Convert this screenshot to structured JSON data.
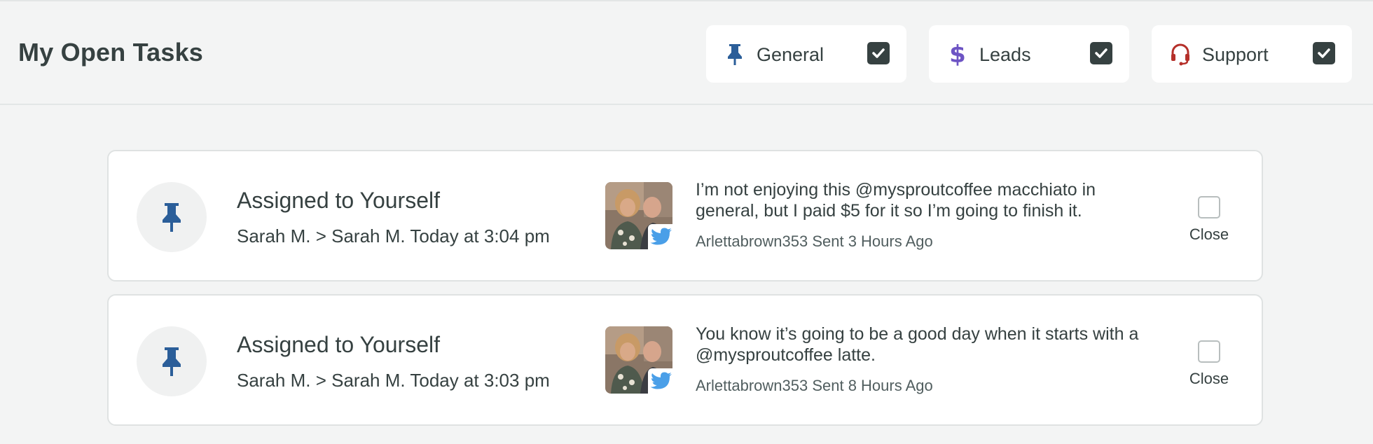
{
  "page": {
    "title": "My Open Tasks"
  },
  "filters": [
    {
      "label": "General",
      "icon": "pin-icon",
      "checked": true,
      "color": "#2b5e99"
    },
    {
      "label": "Leads",
      "icon": "dollar-icon",
      "checked": true,
      "color": "#6d54c4"
    },
    {
      "label": "Support",
      "icon": "headset-icon",
      "checked": true,
      "color": "#b5302a"
    }
  ],
  "tasks": [
    {
      "title": "Assigned to Yourself",
      "meta": "Sarah M. > Sarah M. Today at 3:04 pm",
      "message": "I’m not enjoying this @mysproutcoffee macchiato in general, but I paid $5 for it so I’m going to finish it.",
      "sender_line": "Arlettabrown353 Sent 3 Hours Ago",
      "close_label": "Close",
      "network": "twitter-icon"
    },
    {
      "title": "Assigned to Yourself",
      "meta": "Sarah M. > Sarah M. Today at 3:03 pm",
      "message": "You know it’s going to be a good day when it starts with a @mysproutcoffee latte.",
      "sender_line": "Arlettabrown353 Sent 8 Hours Ago",
      "close_label": "Close",
      "network": "twitter-icon"
    }
  ],
  "colors": {
    "accent_dark": "#364141",
    "twitter": "#4a9fe8",
    "pin": "#2b5e99"
  }
}
